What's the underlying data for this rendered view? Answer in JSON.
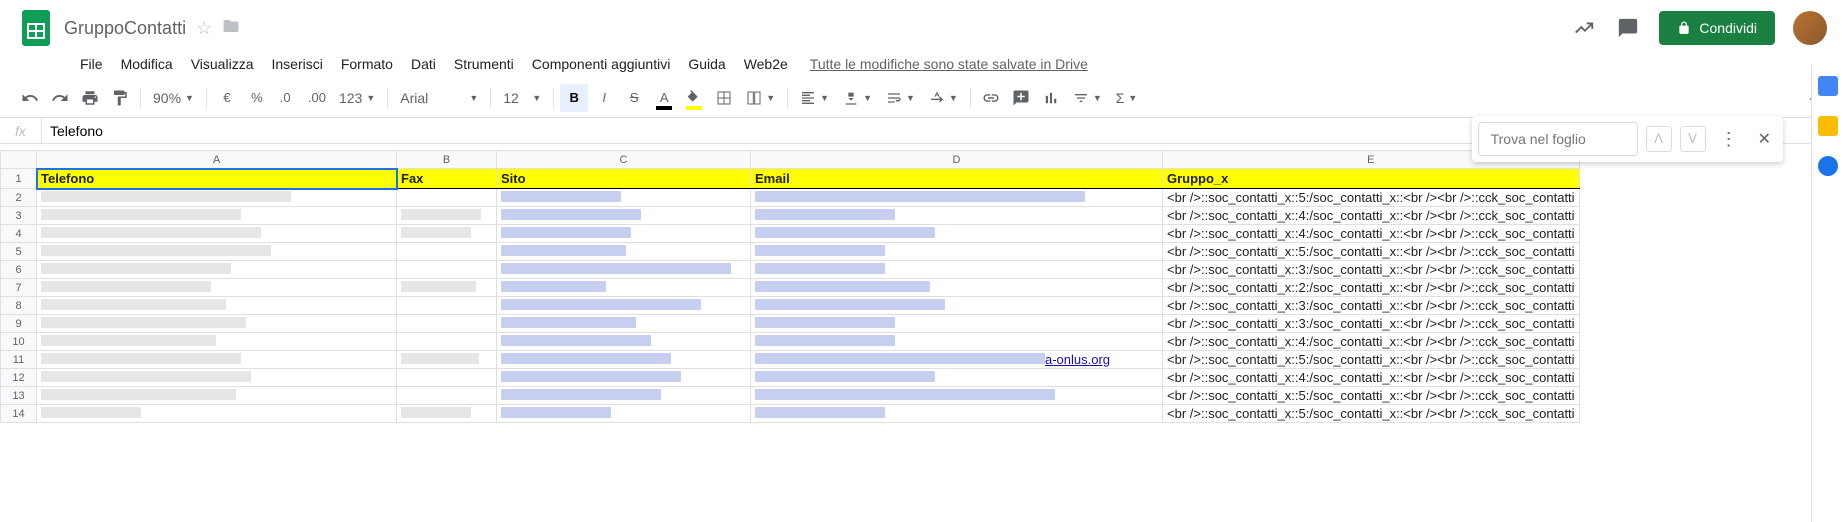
{
  "doc": {
    "title": "GruppoContatti"
  },
  "menus": [
    "File",
    "Modifica",
    "Visualizza",
    "Inserisci",
    "Formato",
    "Dati",
    "Strumenti",
    "Componenti aggiuntivi",
    "Guida",
    "Web2e"
  ],
  "save_status": "Tutte le modifiche sono state salvate in Drive",
  "share": {
    "label": "Condividi"
  },
  "toolbar": {
    "zoom": "90%",
    "font": "Arial",
    "font_size": "12",
    "num_format": "123"
  },
  "formula": {
    "value": "Telefono"
  },
  "find": {
    "placeholder": "Trova nel foglio"
  },
  "columns": [
    "A",
    "B",
    "C",
    "D",
    "E"
  ],
  "header_row": {
    "A": "Telefono",
    "B": "Fax",
    "C": "Sito",
    "D": "Email",
    "E": "Gruppo_x"
  },
  "gruppo_base": "<br />::soc_contatti_x::",
  "gruppo_values": [
    5,
    4,
    4,
    5,
    3,
    2,
    3,
    3,
    4,
    5,
    4,
    5,
    5
  ],
  "gruppo_suffix": ":/soc_contatti_x::<br /><br />::cck_soc_contatti",
  "visible_link_fragment": "a-onlus.org",
  "row_count": 14,
  "chart_data": {
    "type": "table",
    "columns": [
      "Telefono",
      "Fax",
      "Sito",
      "Email",
      "Gruppo_x"
    ],
    "note": "Rows 2-14 contain contact data. Columns A-D are redacted/blurred in the source image; column E contains templated strings of the form '<br />::soc_contatti_x::N:/soc_contatti_x::<br /><br />::cck_soc_contatti' with N given below.",
    "gruppo_N": [
      5,
      4,
      4,
      5,
      3,
      2,
      3,
      3,
      4,
      5,
      4,
      5,
      5
    ]
  }
}
